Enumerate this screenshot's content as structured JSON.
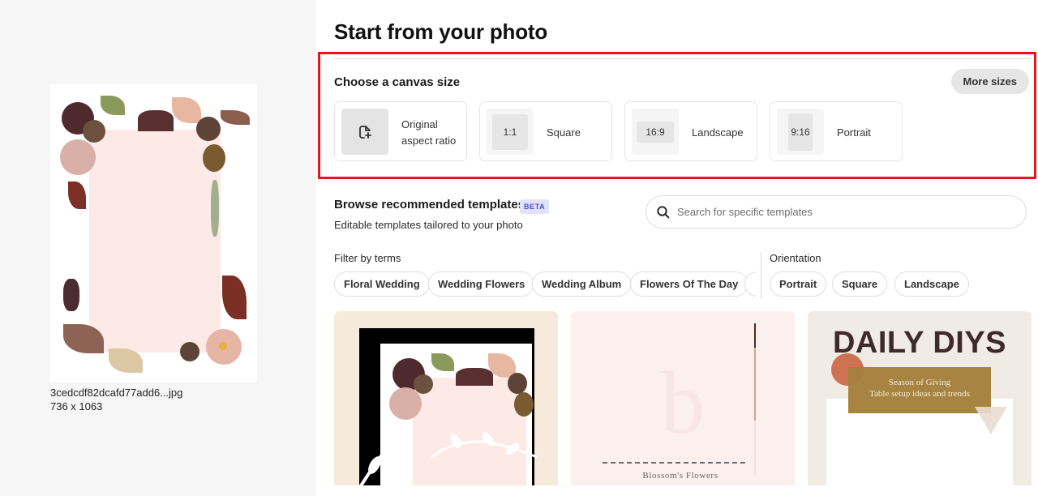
{
  "photo": {
    "file_name": "3cedcdf82dcafd77add6...jpg",
    "dimensions": "736 x 1063"
  },
  "header": {
    "title": "Start from your photo"
  },
  "canvas_size": {
    "label": "Choose a canvas size",
    "more_sizes_label": "More sizes",
    "options": [
      {
        "id": "original",
        "icon": "file-add-icon",
        "label_line1": "Original",
        "label_line2": "aspect ratio"
      },
      {
        "id": "square",
        "ratio": "1:1",
        "label": "Square"
      },
      {
        "id": "landscape",
        "ratio": "16:9",
        "label": "Landscape"
      },
      {
        "id": "portrait",
        "ratio": "9:16",
        "label": "Portrait"
      }
    ],
    "highlight_color": "#e3161d"
  },
  "templates": {
    "title": "Browse recommended templates",
    "badge": "BETA",
    "subtitle": "Editable templates tailored to your photo",
    "search_placeholder": "Search for specific templates",
    "filter_label": "Filter by terms",
    "filter_terms": [
      "Floral Wedding",
      "Wedding Flowers",
      "Wedding Album",
      "Flowers Of The Day"
    ],
    "orientation_label": "Orientation",
    "orientations": [
      "Portrait",
      "Square",
      "Landscape"
    ],
    "cards": [
      {
        "name": "floral-frame-template"
      },
      {
        "name": "blossoms-flowers-template",
        "monogram": "b",
        "caption": "Blossom's Flowers"
      },
      {
        "name": "daily-diys-template",
        "headline": "DAILY DIYS",
        "line1": "Season of Giving",
        "line2": "Table setup ideas and trends"
      }
    ]
  }
}
